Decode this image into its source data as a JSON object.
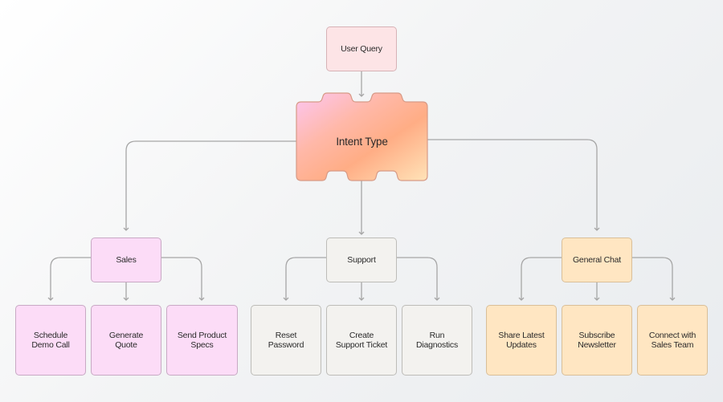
{
  "diagram": {
    "type": "decision-tree",
    "root": {
      "id": "user-query",
      "label": "User Query"
    },
    "decision": {
      "id": "intent-type",
      "label": "Intent Type"
    },
    "categories": [
      {
        "id": "sales",
        "label": "Sales",
        "color": "#fcdcf7",
        "children": [
          {
            "label": "Schedule\nDemo Call"
          },
          {
            "label": "Generate\nQuote"
          },
          {
            "label": "Send Product\nSpecs"
          }
        ]
      },
      {
        "id": "support",
        "label": "Support",
        "color": "#f3f2ef",
        "children": [
          {
            "label": "Reset\nPassword"
          },
          {
            "label": "Create\nSupport Ticket"
          },
          {
            "label": "Run\nDiagnostics"
          }
        ]
      },
      {
        "id": "general-chat",
        "label": "General Chat",
        "color": "#ffe6c2",
        "children": [
          {
            "label": "Share Latest\nUpdates"
          },
          {
            "label": "Subscribe\nNewsletter"
          },
          {
            "label": "Connect with\nSales Team"
          }
        ]
      }
    ],
    "colors": {
      "root": "#fde4e6",
      "decision_gradient": [
        "#fcc6f2",
        "#ffb8a8",
        "#ffad85",
        "#ffe3b8"
      ],
      "edge": "#a6a6a6"
    }
  }
}
